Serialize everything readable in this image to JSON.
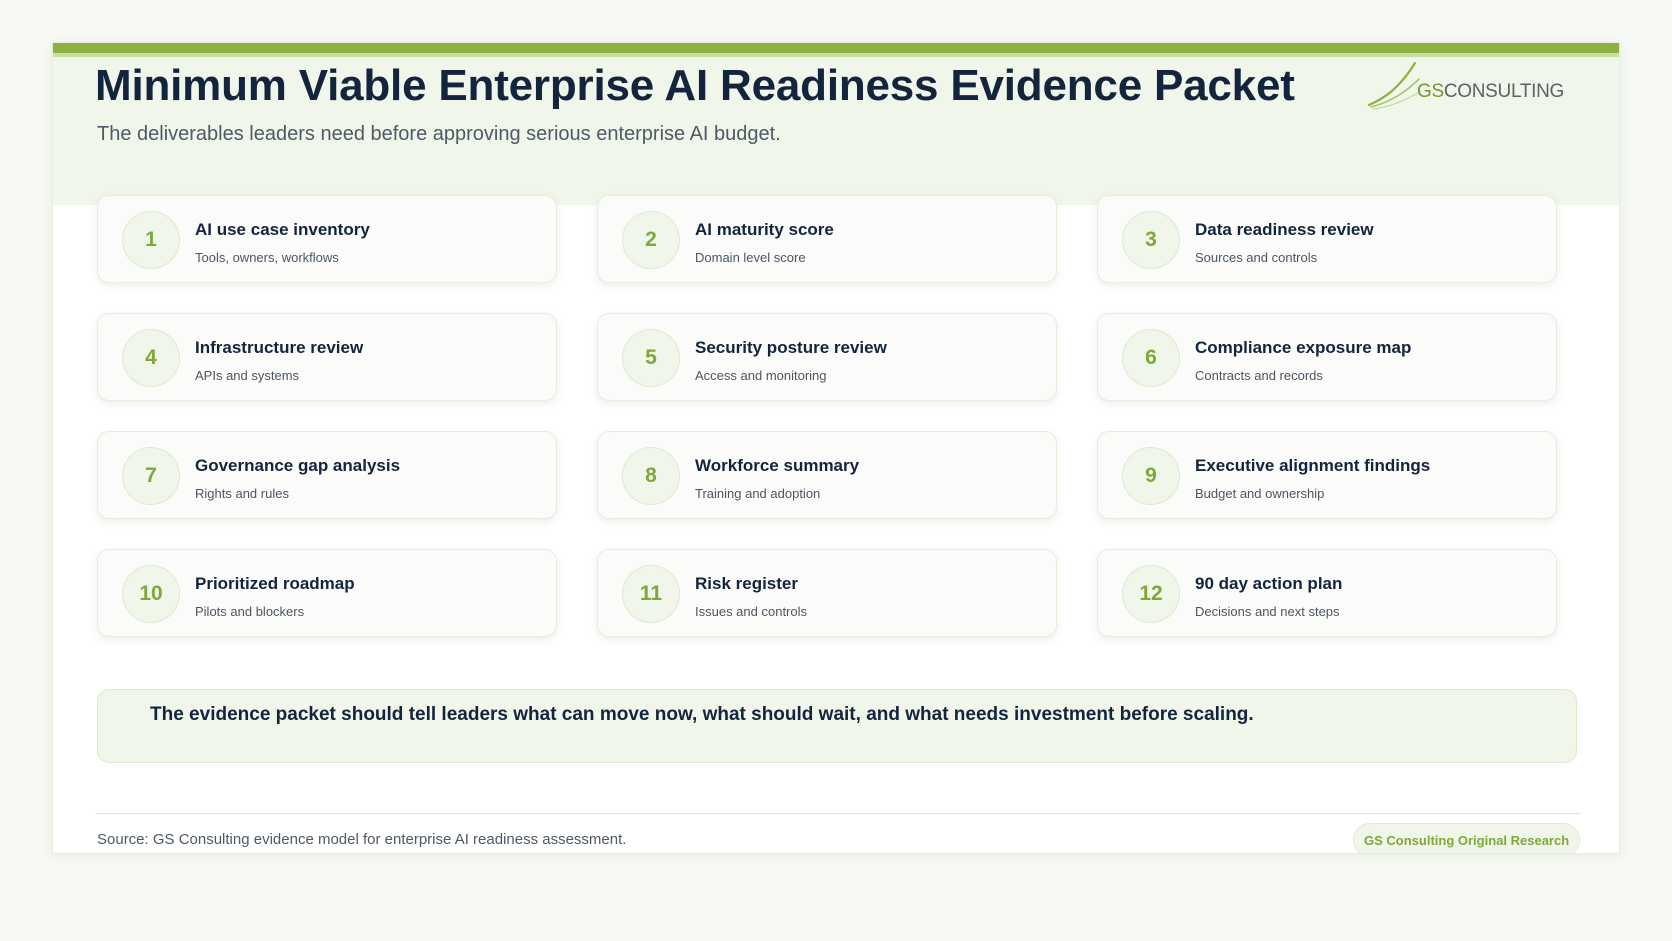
{
  "header": {
    "title": "Minimum Viable Enterprise AI Readiness Evidence Packet",
    "subtitle": "The deliverables leaders need before approving serious enterprise AI budget.",
    "logo": {
      "prefix": "GS",
      "suffix": "CONSULTING"
    }
  },
  "cards": [
    {
      "number": "1",
      "title": "AI use case inventory",
      "subtitle": "Tools, owners, workflows"
    },
    {
      "number": "2",
      "title": "AI maturity score",
      "subtitle": "Domain level score"
    },
    {
      "number": "3",
      "title": "Data readiness review",
      "subtitle": "Sources and controls"
    },
    {
      "number": "4",
      "title": "Infrastructure review",
      "subtitle": "APIs and systems"
    },
    {
      "number": "5",
      "title": "Security posture review",
      "subtitle": "Access and monitoring"
    },
    {
      "number": "6",
      "title": "Compliance exposure map",
      "subtitle": "Contracts and records"
    },
    {
      "number": "7",
      "title": "Governance gap analysis",
      "subtitle": "Rights and rules"
    },
    {
      "number": "8",
      "title": "Workforce summary",
      "subtitle": "Training and adoption"
    },
    {
      "number": "9",
      "title": "Executive alignment findings",
      "subtitle": "Budget and ownership"
    },
    {
      "number": "10",
      "title": "Prioritized roadmap",
      "subtitle": "Pilots and blockers"
    },
    {
      "number": "11",
      "title": "Risk register",
      "subtitle": "Issues and controls"
    },
    {
      "number": "12",
      "title": "90 day action plan",
      "subtitle": "Decisions and next steps"
    }
  ],
  "callout": {
    "text": "The evidence packet should tell leaders what can move now, what should wait, and what needs investment before scaling."
  },
  "footer": {
    "source": "Source: GS Consulting evidence model for enterprise AI readiness assessment.",
    "badge": "GS Consulting Original Research"
  },
  "colors": {
    "accent": "#8db140",
    "number": "#7ea83a",
    "title": "#13243d",
    "header_bg": "#f1f6ea"
  }
}
